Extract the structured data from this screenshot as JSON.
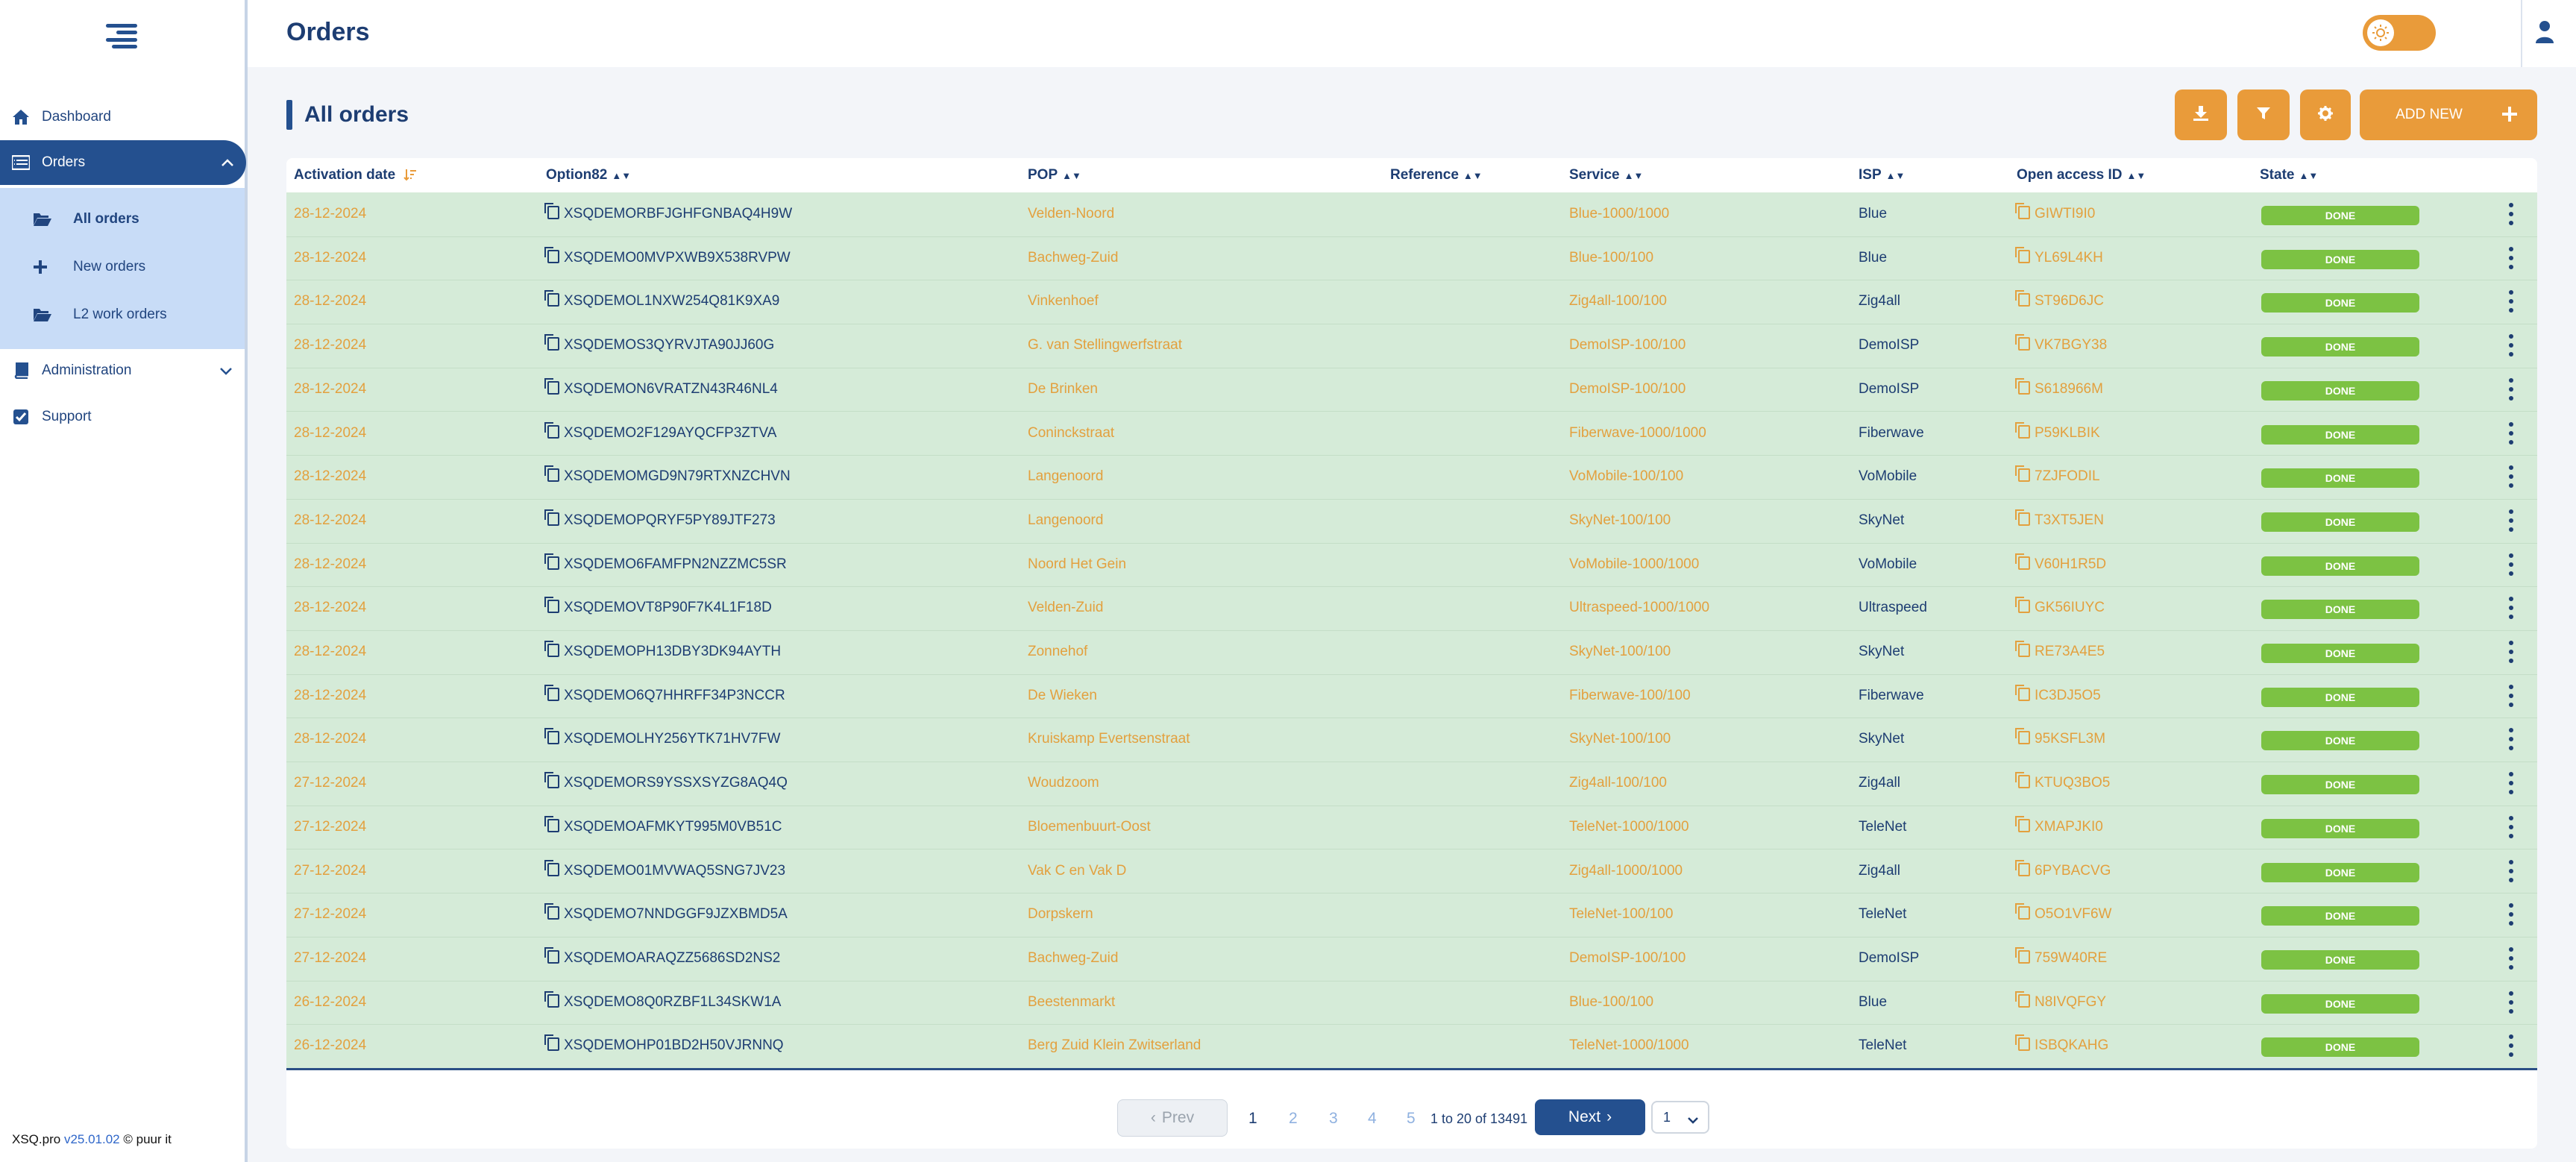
{
  "sidebar": {
    "nav": [
      {
        "label": "Dashboard",
        "icon": "home-icon"
      },
      {
        "label": "Orders",
        "icon": "list-icon"
      },
      {
        "label": "Administration",
        "icon": "book-icon"
      },
      {
        "label": "Support",
        "icon": "check-square-icon"
      }
    ],
    "sub_items": [
      {
        "label": "All orders",
        "icon": "folder-open-icon"
      },
      {
        "label": "New orders",
        "icon": "plus-icon"
      },
      {
        "label": "L2 work orders",
        "icon": "folder-open-icon"
      }
    ],
    "footer": {
      "brand": "XSQ.pro",
      "version": "v25.01.02",
      "suffix": "© puur it"
    }
  },
  "header": {
    "title": "Orders"
  },
  "main": {
    "section_title": "All orders",
    "add_new_label": "ADD NEW",
    "columns": [
      "Activation date",
      "Option82",
      "POP",
      "Reference",
      "Service",
      "ISP",
      "Open access ID",
      "State"
    ],
    "rows": [
      {
        "date": "28-12-2024",
        "option82": "XSQDEMORBFJGHFGNBAQ4H9W",
        "pop": "Velden-Noord",
        "reference": "",
        "service": "Blue-1000/1000",
        "isp": "Blue",
        "oaid": "GIWTI9I0",
        "state": "DONE"
      },
      {
        "date": "28-12-2024",
        "option82": "XSQDEMO0MVPXWB9X538RVPW",
        "pop": "Bachweg-Zuid",
        "reference": "",
        "service": "Blue-100/100",
        "isp": "Blue",
        "oaid": "YL69L4KH",
        "state": "DONE"
      },
      {
        "date": "28-12-2024",
        "option82": "XSQDEMOL1NXW254Q81K9XA9",
        "pop": "Vinkenhoef",
        "reference": "",
        "service": "Zig4all-100/100",
        "isp": "Zig4all",
        "oaid": "ST96D6JC",
        "state": "DONE"
      },
      {
        "date": "28-12-2024",
        "option82": "XSQDEMOS3QYRVJTA90JJ60G",
        "pop": "G. van Stellingwerfstraat",
        "reference": "",
        "service": "DemoISP-100/100",
        "isp": "DemoISP",
        "oaid": "VK7BGY38",
        "state": "DONE"
      },
      {
        "date": "28-12-2024",
        "option82": "XSQDEMON6VRATZN43R46NL4",
        "pop": "De Brinken",
        "reference": "",
        "service": "DemoISP-100/100",
        "isp": "DemoISP",
        "oaid": "S618966M",
        "state": "DONE"
      },
      {
        "date": "28-12-2024",
        "option82": "XSQDEMO2F129AYQCFP3ZTVA",
        "pop": "Coninckstraat",
        "reference": "",
        "service": "Fiberwave-1000/1000",
        "isp": "Fiberwave",
        "oaid": "P59KLBIK",
        "state": "DONE"
      },
      {
        "date": "28-12-2024",
        "option82": "XSQDEMOMGD9N79RTXNZCHVN",
        "pop": "Langenoord",
        "reference": "",
        "service": "VoMobile-100/100",
        "isp": "VoMobile",
        "oaid": "7ZJFODIL",
        "state": "DONE"
      },
      {
        "date": "28-12-2024",
        "option82": "XSQDEMOPQRYF5PY89JTF273",
        "pop": "Langenoord",
        "reference": "",
        "service": "SkyNet-100/100",
        "isp": "SkyNet",
        "oaid": "T3XT5JEN",
        "state": "DONE"
      },
      {
        "date": "28-12-2024",
        "option82": "XSQDEMO6FAMFPN2NZZMC5SR",
        "pop": "Noord Het Gein",
        "reference": "",
        "service": "VoMobile-1000/1000",
        "isp": "VoMobile",
        "oaid": "V60H1R5D",
        "state": "DONE"
      },
      {
        "date": "28-12-2024",
        "option82": "XSQDEMOVT8P90F7K4L1F18D",
        "pop": "Velden-Zuid",
        "reference": "",
        "service": "Ultraspeed-1000/1000",
        "isp": "Ultraspeed",
        "oaid": "GK56IUYC",
        "state": "DONE"
      },
      {
        "date": "28-12-2024",
        "option82": "XSQDEMOPH13DBY3DK94AYTH",
        "pop": "Zonnehof",
        "reference": "",
        "service": "SkyNet-100/100",
        "isp": "SkyNet",
        "oaid": "RE73A4E5",
        "state": "DONE"
      },
      {
        "date": "28-12-2024",
        "option82": "XSQDEMO6Q7HHRFF34P3NCCR",
        "pop": "De Wieken",
        "reference": "",
        "service": "Fiberwave-100/100",
        "isp": "Fiberwave",
        "oaid": "IC3DJ5O5",
        "state": "DONE"
      },
      {
        "date": "28-12-2024",
        "option82": "XSQDEMOLHY256YTK71HV7FW",
        "pop": "Kruiskamp Evertsenstraat",
        "reference": "",
        "service": "SkyNet-100/100",
        "isp": "SkyNet",
        "oaid": "95KSFL3M",
        "state": "DONE"
      },
      {
        "date": "27-12-2024",
        "option82": "XSQDEMORS9YSSXSYZG8AQ4Q",
        "pop": "Woudzoom",
        "reference": "",
        "service": "Zig4all-100/100",
        "isp": "Zig4all",
        "oaid": "KTUQ3BO5",
        "state": "DONE"
      },
      {
        "date": "27-12-2024",
        "option82": "XSQDEMOAFMKYT995M0VB51C",
        "pop": "Bloemenbuurt-Oost",
        "reference": "",
        "service": "TeleNet-1000/1000",
        "isp": "TeleNet",
        "oaid": "XMAPJKI0",
        "state": "DONE"
      },
      {
        "date": "27-12-2024",
        "option82": "XSQDEMO01MVWAQ5SNG7JV23",
        "pop": "Vak C en Vak D",
        "reference": "",
        "service": "Zig4all-1000/1000",
        "isp": "Zig4all",
        "oaid": "6PYBACVG",
        "state": "DONE"
      },
      {
        "date": "27-12-2024",
        "option82": "XSQDEMO7NNDGGF9JZXBMD5A",
        "pop": "Dorpskern",
        "reference": "",
        "service": "TeleNet-100/100",
        "isp": "TeleNet",
        "oaid": "O5O1VF6W",
        "state": "DONE"
      },
      {
        "date": "27-12-2024",
        "option82": "XSQDEMOARAQZZ5686SD2NS2",
        "pop": "Bachweg-Zuid",
        "reference": "",
        "service": "DemoISP-100/100",
        "isp": "DemoISP",
        "oaid": "759W40RE",
        "state": "DONE"
      },
      {
        "date": "26-12-2024",
        "option82": "XSQDEMO8Q0RZBF1L34SKW1A",
        "pop": "Beestenmarkt",
        "reference": "",
        "service": "Blue-100/100",
        "isp": "Blue",
        "oaid": "N8IVQFGY",
        "state": "DONE"
      },
      {
        "date": "26-12-2024",
        "option82": "XSQDEMOHP01BD2H50VJRNNQ",
        "pop": "Berg Zuid Klein Zwitserland",
        "reference": "",
        "service": "TeleNet-1000/1000",
        "isp": "TeleNet",
        "oaid": "ISBQKAHG",
        "state": "DONE"
      }
    ]
  },
  "pagination": {
    "prev_label": "Prev",
    "pages": [
      "1",
      "2",
      "3",
      "4",
      "5"
    ],
    "range_text": "1 to 20 of 13491",
    "next_label": "Next",
    "page_select": "1"
  },
  "colors": {
    "primary": "#24508f",
    "accent": "#e99b3a",
    "row_bg": "#d5ebd8",
    "done_badge": "#7cc243"
  }
}
